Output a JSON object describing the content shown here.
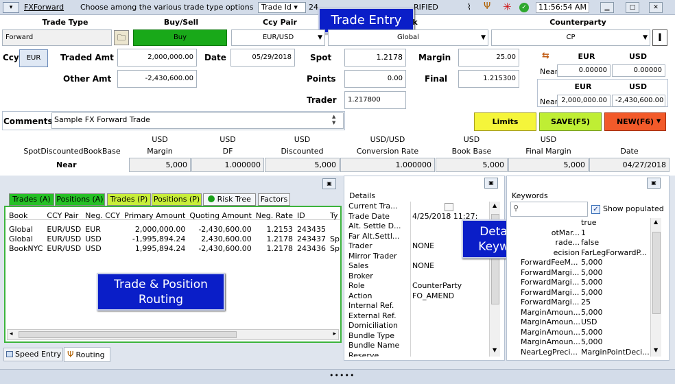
{
  "titlebar": {
    "trade_type": "FXForward",
    "hint": "Choose among the various trade type options",
    "trade_id_label": "Trade Id",
    "trade_id_value": "24",
    "status": "RIFIED",
    "time": "11:56:54 AM"
  },
  "callouts": {
    "trade_entry": "Trade Entry",
    "details_keywords": [
      "Details &",
      "Keywords"
    ],
    "routing": [
      "Trade & Position",
      "Routing"
    ]
  },
  "headers": {
    "trade_type": "Trade Type",
    "buy_sell": "Buy/Sell",
    "ccy_pair": "Ccy Pair",
    "book": "k",
    "counterparty": "Counterparty"
  },
  "row1": {
    "trade_type": "Forward",
    "buy_sell": "Buy",
    "ccy_pair": "EUR/USD",
    "book": "Global",
    "counterparty": "CP"
  },
  "labels": {
    "ccy": "Ccy",
    "traded_amt": "Traded Amt",
    "date": "Date",
    "spot": "Spot",
    "margin": "Margin",
    "other_amt": "Other Amt",
    "points": "Points",
    "final": "Final",
    "trader": "Trader",
    "comments": "Comments",
    "near": "Near"
  },
  "values": {
    "ccy": "EUR",
    "traded_amt": "2,000,000.00",
    "date": "05/29/2018",
    "spot": "1.2178",
    "margin": "25.00",
    "other_amt": "-2,430,600.00",
    "points": "0.00",
    "final": "1.215300",
    "trader": "1.217800",
    "comments": "Sample FX Forward Trade"
  },
  "rate_panel": {
    "cur1": "EUR",
    "cur2": "USD",
    "near1": "0.00000",
    "near2": "0.00000",
    "near3": "2,000,000.00",
    "near4": "-2,430,600.00"
  },
  "buttons": {
    "limits": "Limits",
    "save": "SAVE(F5)",
    "new": "NEW(F6)"
  },
  "summary": {
    "cols": [
      {
        "h1": "",
        "h2": "SpotDiscountedBookBase",
        "val": ""
      },
      {
        "h1": "USD",
        "h2": "Margin",
        "val": "5,000"
      },
      {
        "h1": "USD",
        "h2": "DF",
        "val": "1.000000"
      },
      {
        "h1": "USD",
        "h2": "Discounted",
        "val": "5,000"
      },
      {
        "h1": "USD/USD",
        "h2": "Conversion Rate",
        "val": "1.000000"
      },
      {
        "h1": "USD",
        "h2": "Book Base",
        "val": "5,000"
      },
      {
        "h1": "USD",
        "h2": "Final Margin",
        "val": "5,000"
      },
      {
        "h1": "",
        "h2": "Date",
        "val": "04/27/2018"
      }
    ],
    "row_label": "Near"
  },
  "tabs": [
    "Trades (A)",
    "Positions (A)",
    "Trades (P)",
    "Positions (P)",
    "Risk Tree",
    "Factors"
  ],
  "grid": {
    "headers": [
      "Book",
      "CCY Pair",
      "Neg. CCY",
      "Primary Amount",
      "Quoting Amount",
      "Neg. Rate",
      "ID",
      "Ty"
    ],
    "rows": [
      [
        "Global",
        "EUR/USD",
        "EUR",
        "2,000,000.00",
        "-2,430,600.00",
        "1.2153",
        "243435",
        ""
      ],
      [
        "Global",
        "EUR/USD",
        "USD",
        "-1,995,894.24",
        "2,430,600.00",
        "1.2178",
        "243437",
        "Sp"
      ],
      [
        "BookNYC",
        "EUR/USD",
        "USD",
        "1,995,894.24",
        "-2,430,600.00",
        "1.2178",
        "243436",
        "Sp"
      ]
    ]
  },
  "bottom_tabs": {
    "speed": "Speed Entry",
    "routing": "Routing"
  },
  "details": {
    "title": "Details",
    "rows": [
      {
        "k": "Current Tra...",
        "v": ""
      },
      {
        "k": "Trade Date",
        "v": "4/25/2018 11:27:"
      },
      {
        "k": "Alt. Settle D...",
        "v": ""
      },
      {
        "k": "Far Alt.Settl...",
        "v": ""
      },
      {
        "k": "Trader",
        "v": "NONE"
      },
      {
        "k": "Mirror Trader",
        "v": ""
      },
      {
        "k": "Sales",
        "v": "NONE"
      },
      {
        "k": "Broker",
        "v": ""
      },
      {
        "k": "Role",
        "v": "CounterParty"
      },
      {
        "k": "Action",
        "v": "FO_AMEND"
      },
      {
        "k": "Internal Ref.",
        "v": ""
      },
      {
        "k": "External Ref.",
        "v": ""
      },
      {
        "k": "Domiciliation",
        "v": ""
      },
      {
        "k": "Bundle Type",
        "v": ""
      },
      {
        "k": "Bundle Name",
        "v": ""
      },
      {
        "k": "Reserve",
        "v": ""
      }
    ]
  },
  "keywords": {
    "title": "Keywords",
    "search_placeholder": "",
    "show_populated": "Show populated",
    "rows": [
      {
        "k": "",
        "v": "true"
      },
      {
        "k": "otMar...",
        "v": "1"
      },
      {
        "k": "rade...",
        "v": "false"
      },
      {
        "k": "ecision",
        "v": "FarLegForwardP..."
      },
      {
        "k": "ForwardFeeM...",
        "v": "5,000"
      },
      {
        "k": "ForwardMargi...",
        "v": "5,000"
      },
      {
        "k": "ForwardMargi...",
        "v": "5,000"
      },
      {
        "k": "ForwardMargi...",
        "v": "5,000"
      },
      {
        "k": "ForwardMargi...",
        "v": "25"
      },
      {
        "k": "MarginAmoun...",
        "v": "5,000"
      },
      {
        "k": "MarginAmoun...",
        "v": "USD"
      },
      {
        "k": "MarginAmoun...",
        "v": "5,000"
      },
      {
        "k": "MarginAmoun...",
        "v": "5,000"
      },
      {
        "k": "NearLegPreci...",
        "v": "MarginPointDeci..."
      }
    ]
  },
  "colors": {
    "buy_green": "#19a919",
    "limits_yellow": "#f5f53a",
    "save_green": "#bfee34",
    "new_orange": "#f25a2a",
    "callout_blue": "#0a1ec8",
    "tab_green": "#26c026",
    "tab_lime": "#c8ee3a"
  }
}
